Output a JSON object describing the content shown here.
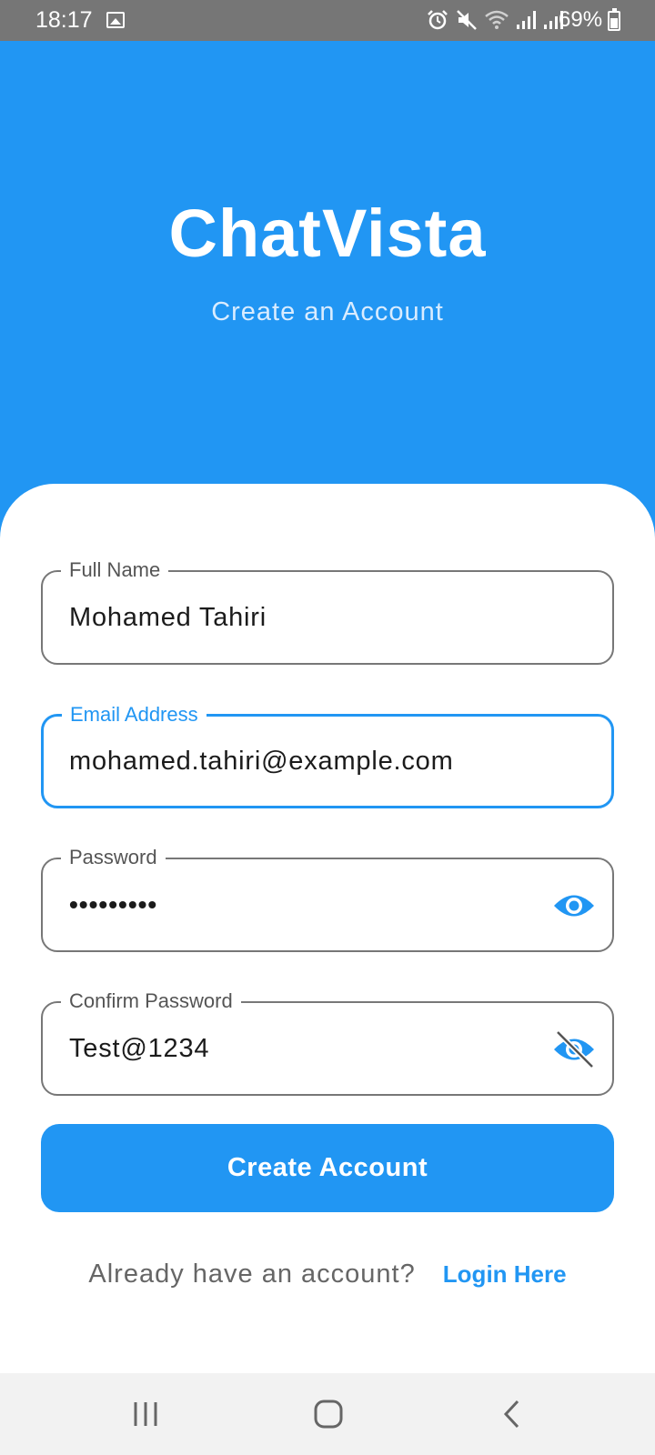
{
  "status_bar": {
    "time": "18:17",
    "battery": "69%"
  },
  "header": {
    "app_title": "ChatVista",
    "subtitle": "Create an Account"
  },
  "form": {
    "full_name": {
      "label": "Full Name",
      "value": "Mohamed Tahiri"
    },
    "email": {
      "label": "Email Address",
      "value": "mohamed.tahiri@example.com"
    },
    "password": {
      "label": "Password",
      "value": "•••••••••"
    },
    "confirm_password": {
      "label": "Confirm Password",
      "value": "Test@1234"
    }
  },
  "actions": {
    "create_account": "Create Account",
    "login_prompt": "Already have an account?",
    "login_link": "Login Here"
  },
  "colors": {
    "primary": "#2196f3",
    "status_bar": "#767676",
    "nav_bar": "#f2f2f2"
  }
}
